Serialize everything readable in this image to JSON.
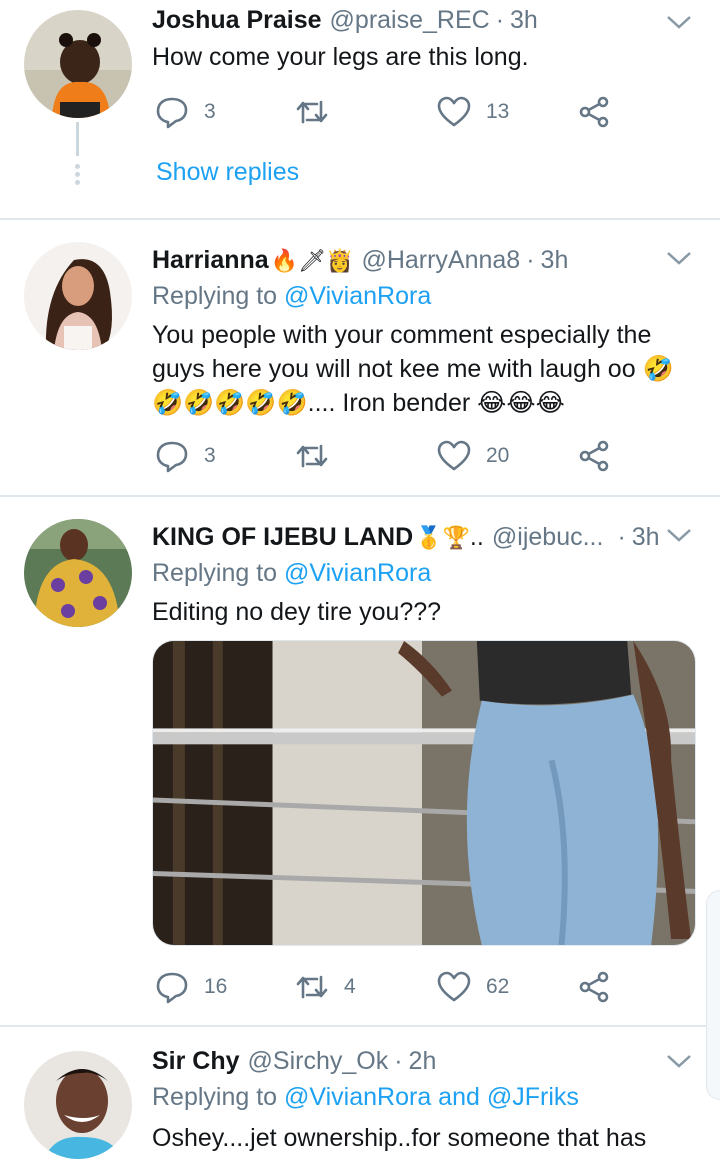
{
  "tweets": [
    {
      "name": "Joshua Praise",
      "handle": "@praise_REC",
      "time": "3h",
      "text": "How come your legs are this long.",
      "replies": "3",
      "retweets": "",
      "likes": "13",
      "show_replies": "Show replies"
    },
    {
      "name": "Harrianna",
      "name_emoji": "🔥🗡👸",
      "handle": "@HarryAnna8",
      "time": "3h",
      "replying_prefix": "Replying to ",
      "replying_to": "@VivianRora",
      "text_line1": "You people with your comment especially the",
      "text_line2": "guys here you will not kee me with laugh oo 🤣",
      "text_line3": "🤣🤣🤣🤣🤣.... Iron bender 😂😂😂",
      "replies": "3",
      "retweets": "",
      "likes": "20"
    },
    {
      "name": "KING OF IJEBU LAND",
      "name_emoji": "🥇🏆..",
      "handle": "@ijebuc...",
      "time": "3h",
      "replying_prefix": "Replying to ",
      "replying_to": "@VivianRora",
      "text": "Editing no dey tire you???",
      "replies": "16",
      "retweets": "4",
      "likes": "62"
    },
    {
      "name": "Sir Chy",
      "handle": "@Sirchy_Ok",
      "time": "2h",
      "replying_prefix": "Replying to ",
      "replying_to": "@VivianRora and @JFriks",
      "text": "Oshey....jet ownership..for someone that has"
    }
  ],
  "separator": "·",
  "colors": {
    "accent": "#1da1f2",
    "muted": "#657786",
    "divider": "#e1e8ed"
  },
  "icons": [
    "reply-icon",
    "retweet-icon",
    "like-icon",
    "share-icon",
    "chevron-down-icon"
  ]
}
